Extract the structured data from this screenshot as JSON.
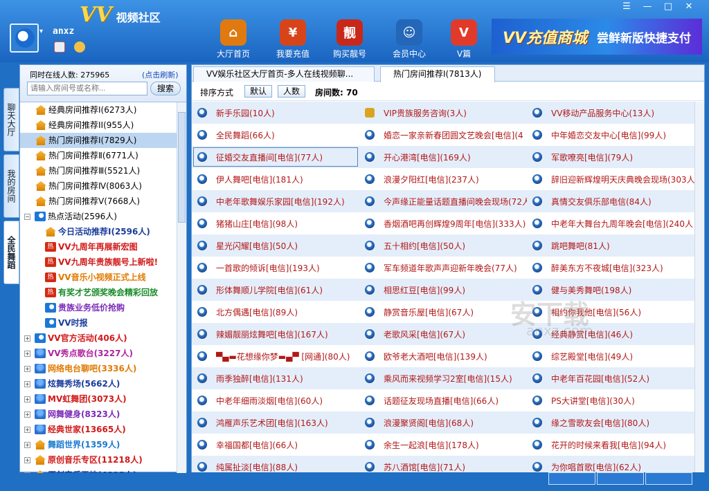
{
  "app": {
    "logo_mark": "VV",
    "logo_text": "视频社区",
    "username": "anxz"
  },
  "nav": [
    {
      "label": "大厅首页",
      "icon": "house-icon",
      "glyph": "⌂",
      "color": "#e07a10"
    },
    {
      "label": "我要充值",
      "icon": "money-bag-icon",
      "glyph": "¥",
      "color": "#d8441a"
    },
    {
      "label": "购买靓号",
      "icon": "pretty-number-badge-icon",
      "glyph": "靓",
      "color": "#c8281a"
    },
    {
      "label": "会员中心",
      "icon": "members-icon",
      "glyph": "☺",
      "color": "#2466b8"
    },
    {
      "label": "V篇",
      "icon": "v-logo-icon",
      "glyph": "V",
      "color": "#e23a2a"
    }
  ],
  "banner": {
    "text1": "VV充值商城",
    "text2": "尝鲜新版快捷支付"
  },
  "window": {
    "menu": "☰",
    "minimize": "—",
    "maximize": "□",
    "close": "✕"
  },
  "vtabs": [
    "聊天大厅",
    "我的房间",
    "全民舞蹈"
  ],
  "side": {
    "online_label": "同时在线人数: 275965",
    "refresh": "(点击刷新)",
    "search_placeholder": "请输入房间号或名称...",
    "search_button": "搜索"
  },
  "tree": [
    {
      "label": "经典房间推荐I(6273人)",
      "indent": 1,
      "icon": "house",
      "color": "#000",
      "bold": false
    },
    {
      "label": "经典房间推荐II(955人)",
      "indent": 1,
      "icon": "house",
      "color": "#000",
      "bold": false
    },
    {
      "label": "热门房间推荐Ⅰ(7829人)",
      "indent": 1,
      "icon": "house",
      "color": "#000",
      "bold": false,
      "selected": true
    },
    {
      "label": "热门房间推荐Ⅱ(6771人)",
      "indent": 1,
      "icon": "house",
      "color": "#000",
      "bold": false
    },
    {
      "label": "热门房间推荐Ⅲ(5521人)",
      "indent": 1,
      "icon": "house",
      "color": "#000",
      "bold": false
    },
    {
      "label": "热门房间推荐Ⅳ(8063人)",
      "indent": 1,
      "icon": "house",
      "color": "#000",
      "bold": false
    },
    {
      "label": "热门房间推荐Ⅴ(7668人)",
      "indent": 1,
      "icon": "house",
      "color": "#000",
      "bold": false
    },
    {
      "label": "热点活动(2596人)",
      "indent": 0,
      "pm": "−",
      "icon": "ie",
      "color": "#000",
      "bold": false
    },
    {
      "label": "今日活动推荐Ⅰ(2596人)",
      "indent": 2,
      "icon": "house",
      "color": "#1a3c9c",
      "bold": true
    },
    {
      "label": "VV九周年再展新宏图",
      "indent": 2,
      "icon": "hot",
      "color": "#d21818",
      "bold": true
    },
    {
      "label": "VV九周年贵族靓号上新啦!",
      "indent": 2,
      "icon": "hot",
      "color": "#d21818",
      "bold": true
    },
    {
      "label": "VV音乐小视频正式上线",
      "indent": 2,
      "icon": "hot",
      "color": "#e07a00",
      "bold": true
    },
    {
      "label": "有奖才艺颁奖晚会精彩回放",
      "indent": 2,
      "icon": "hot",
      "color": "#1a8a2a",
      "bold": true
    },
    {
      "label": "贵族业务低价抢购",
      "indent": 2,
      "icon": "ie",
      "color": "#7a2ab8",
      "bold": true
    },
    {
      "label": "VV时报",
      "indent": 2,
      "icon": "ie",
      "color": "#1a3c9c",
      "bold": true
    },
    {
      "label": "VV官方活动(406人)",
      "indent": 0,
      "pm": "+",
      "icon": "ie",
      "color": "#d21818",
      "bold": true
    },
    {
      "label": "VV秀点歌台(3227人)",
      "indent": 0,
      "pm": "+",
      "icon": "ppl",
      "color": "#b0249c",
      "bold": true
    },
    {
      "label": "网络电台聊吧(3336人)",
      "indent": 0,
      "pm": "+",
      "icon": "ppl",
      "color": "#e07a00",
      "bold": true
    },
    {
      "label": "炫舞秀场(5662人)",
      "indent": 0,
      "pm": "+",
      "icon": "ppl",
      "color": "#1a3c9c",
      "bold": true
    },
    {
      "label": "MV虹舞团(3073人)",
      "indent": 0,
      "pm": "+",
      "icon": "ppl",
      "color": "#d21818",
      "bold": true
    },
    {
      "label": "网舞健身(8323人)",
      "indent": 0,
      "pm": "+",
      "icon": "ppl",
      "color": "#7a2ab8",
      "bold": true
    },
    {
      "label": "经典世家(13665人)",
      "indent": 0,
      "pm": "+",
      "icon": "ppl",
      "color": "#d21818",
      "bold": true
    },
    {
      "label": "舞蹈世界(1359人)",
      "indent": 0,
      "pm": "+",
      "icon": "house",
      "color": "#1a7ad0",
      "bold": true
    },
    {
      "label": "原创音乐专区(11218人)",
      "indent": 0,
      "pm": "+",
      "icon": "house",
      "color": "#d21818",
      "bold": true
    },
    {
      "label": "原创音乐天地(4098人)",
      "indent": 0,
      "pm": "+",
      "icon": "house",
      "color": "#1a3c9c",
      "bold": true
    }
  ],
  "tabs": [
    "VV娱乐社区大厅首页-多人在线视频聊...",
    "热门房间推荐Ⅰ(7813人)"
  ],
  "sortbar": {
    "label": "排序方式",
    "btn_default": "默认",
    "btn_people": "人数",
    "room_count": "房间数: 70"
  },
  "rooms": [
    [
      "新手乐园(10人)",
      "VIP贵族服务咨询(3人)",
      "VV移动产品服务中心(13人)"
    ],
    [
      "全民舞蹈(66人)",
      "婚恋一家亲新春团圆文艺晚会[电信](4",
      "中年婚恋交友中心[电信](99人)"
    ],
    [
      "征婚交友直播间[电信](77人)",
      "开心港湾[电信](169人)",
      "军歌嘹亮[电信](79人)"
    ],
    [
      "伊人舞吧[电信](181人)",
      "浪漫夕阳红[电信](237人)",
      "辞旧迎新辉煌明天庆典晚会现场(303人"
    ],
    [
      "中老年歌舞娱乐家园[电信](192人)",
      "今声缘正能量话题直播间晚会现场(72人",
      "真情交友俱乐部电信(84人)"
    ],
    [
      "猪猪山庄[电信](98人)",
      "香烟酒吧再创辉煌9周年[电信](333人)",
      "中老年大舞台九周年晚会[电信](240人"
    ],
    [
      "星光闪耀[电信](50人)",
      "五十相约[电信](50人)",
      "跳吧舞吧(81人)"
    ],
    [
      "一首歌的倾诉[电信](193人)",
      "军车频道年歌声声迎新年晚会(77人)",
      "醉美东方不夜城[电信](323人)"
    ],
    [
      "形体舞顺儿学院[电信](61人)",
      "相思红豆[电信](99人)",
      "健与美秀舞吧(198人)"
    ],
    [
      "北方偶遇[电信](89人)",
      "静赏音乐屋[电信](67人)",
      "相约你我他[电信](56人)"
    ],
    [
      "辣媚靓丽炫舞吧[电信](167人)",
      "老歌风采[电信](67人)",
      "经典静赏[电信](46人)"
    ],
    [
      "▀▄▬花想缘你梦▬▄▀ [网通](80人)",
      "欧爷老大酒吧[电信](139人)",
      "综艺殿堂[电信](49人)"
    ],
    [
      "雨季独醉[电信](131人)",
      "乘风而来视频学习2室[电信](15人)",
      "中老年百花园[电信](52人)"
    ],
    [
      "中老年细雨淡烟[电信](60人)",
      "话题征友现场直播[电信](66人)",
      "PS大讲堂[电信](30人)"
    ],
    [
      "鸿雁声乐艺术团[电信](163人)",
      "浪漫聚贤阁[电信](68人)",
      "缘之雪歌友会[电信](80人)"
    ],
    [
      "幸福国都[电信](66人)",
      "余生一起浪[电信](178人)",
      "花开的时候来看我[电信](94人)"
    ],
    [
      "纯属扯淡[电信](88人)",
      "苏八酒馆[电信](71人)",
      "为你唱首歌[电信](62人)"
    ]
  ],
  "watermark": {
    "main": "安下载",
    "sub": "anxz.com"
  }
}
